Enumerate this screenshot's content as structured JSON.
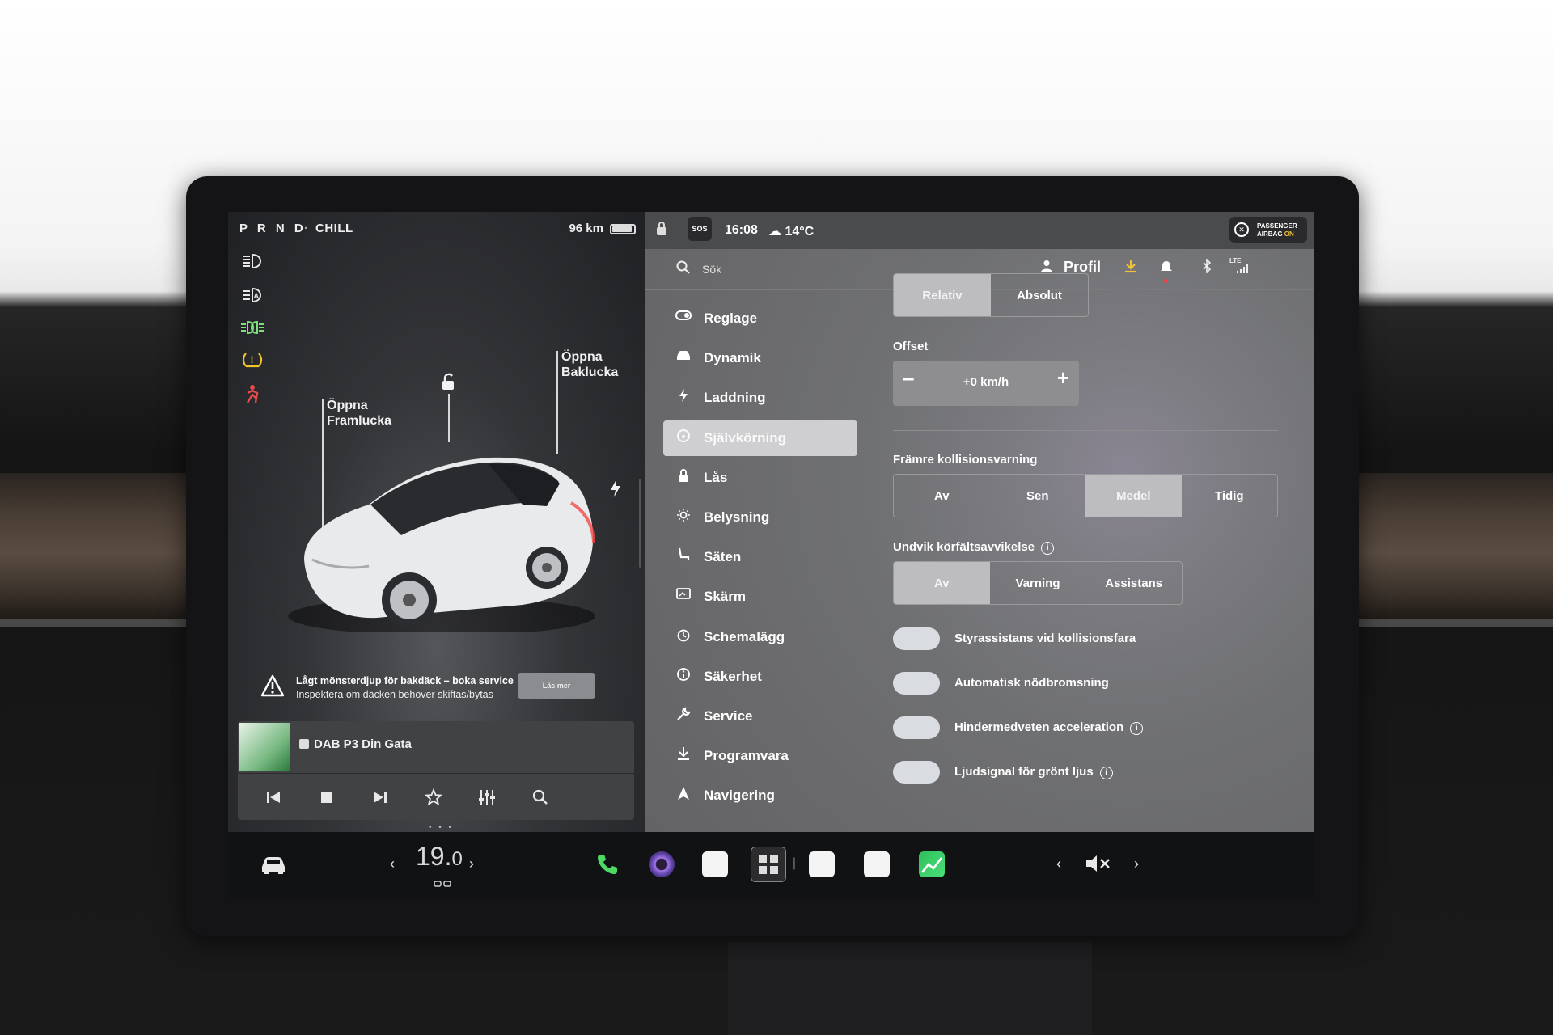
{
  "status_left": {
    "gear": "P R N D",
    "separator": "·",
    "mode": "CHILL",
    "range": "96 km",
    "battery_level": 0.85
  },
  "car_panel": {
    "frunk_label_1": "Öppna",
    "frunk_label_2": "Framlucka",
    "trunk_label_1": "Öppna",
    "trunk_label_2": "Baklucka"
  },
  "alert": {
    "title": "Lågt mönsterdjup för bakdäck – boka service",
    "body": "Inspektera om däcken behöver skiftas/bytas",
    "button": "Läs mer"
  },
  "media": {
    "station": "DAB P3 Din Gata",
    "pager": "• • •"
  },
  "status_right": {
    "sos": "SOS",
    "time": "16:08",
    "temperature": "14°C",
    "airbag_1": "PASSENGER",
    "airbag_2": "AIRBAG",
    "airbag_3": "ON"
  },
  "search": {
    "placeholder": "Sök"
  },
  "profile": {
    "label": "Profil",
    "lte": "LTE"
  },
  "nav": [
    {
      "label": "Reglage",
      "icon": "toggle-icon"
    },
    {
      "label": "Dynamik",
      "icon": "car-icon"
    },
    {
      "label": "Laddning",
      "icon": "lightning-icon"
    },
    {
      "label": "Självkörning",
      "icon": "steering-wheel-icon"
    },
    {
      "label": "Lås",
      "icon": "lock-icon"
    },
    {
      "label": "Belysning",
      "icon": "sun-icon"
    },
    {
      "label": "Säten",
      "icon": "seat-icon"
    },
    {
      "label": "Skärm",
      "icon": "display-icon"
    },
    {
      "label": "Schemalägg",
      "icon": "clock-icon"
    },
    {
      "label": "Säkerhet",
      "icon": "info-icon"
    },
    {
      "label": "Service",
      "icon": "wrench-icon"
    },
    {
      "label": "Programvara",
      "icon": "download-icon"
    },
    {
      "label": "Navigering",
      "icon": "navigation-icon"
    }
  ],
  "settings": {
    "speed_mode": {
      "options": [
        "Relativ",
        "Absolut"
      ],
      "selected": "Relativ"
    },
    "offset_label": "Offset",
    "offset_value": "+0 km/h",
    "fcw_label": "Främre kollisionsvarning",
    "fcw": {
      "options": [
        "Av",
        "Sen",
        "Medel",
        "Tidig"
      ],
      "selected": "Medel"
    },
    "lane_label": "Undvik körfältsavvikelse",
    "lane": {
      "options": [
        "Av",
        "Varning",
        "Assistans"
      ],
      "selected": "Av"
    },
    "toggles": [
      {
        "label": "Styrassistans vid kollisionsfara",
        "info": false
      },
      {
        "label": "Automatisk nödbromsning",
        "info": false
      },
      {
        "label": "Hindermedveten acceleration",
        "info": true
      },
      {
        "label": "Ljudsignal för grönt ljus",
        "info": true
      }
    ]
  },
  "dock": {
    "temp_whole": "19.",
    "temp_decimal": "0"
  }
}
